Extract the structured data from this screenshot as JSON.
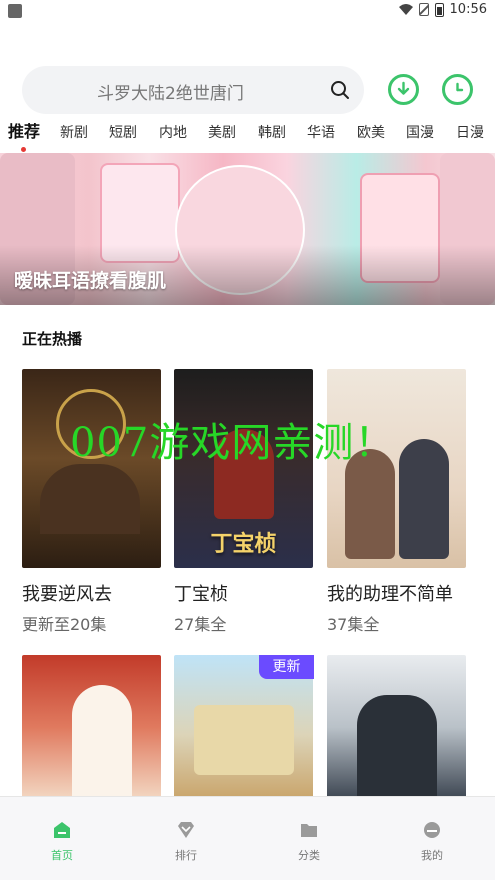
{
  "status_bar": {
    "time": "10:56"
  },
  "search": {
    "placeholder": "斗罗大陆2绝世唐门"
  },
  "icons": {
    "search": "search-icon",
    "download": "download-icon",
    "history": "clock-icon"
  },
  "tabs": [
    "推荐",
    "新剧",
    "短剧",
    "内地",
    "美剧",
    "韩剧",
    "华语",
    "欧美",
    "国漫",
    "日漫"
  ],
  "active_tab": "推荐",
  "banner": {
    "title": "暧昧耳语撩看腹肌"
  },
  "section": {
    "title": "正在热播"
  },
  "cards": [
    {
      "title": "我要逆风去",
      "subtitle": "更新至20集",
      "poster_text": ""
    },
    {
      "title": "丁宝桢",
      "subtitle": "27集全",
      "poster_text": "丁宝桢"
    },
    {
      "title": "我的助理不简单",
      "subtitle": "37集全",
      "poster_text": ""
    },
    {
      "title": "",
      "subtitle": "",
      "poster_text": ""
    },
    {
      "title": "",
      "subtitle": "",
      "poster_text": "",
      "badge": "更新"
    },
    {
      "title": "",
      "subtitle": "",
      "poster_text": ""
    }
  ],
  "watermark": "007游戏网亲测！",
  "bottom_nav": [
    {
      "label": "首页",
      "icon": "home-icon"
    },
    {
      "label": "排行",
      "icon": "rank-icon"
    },
    {
      "label": "分类",
      "icon": "folder-icon"
    },
    {
      "label": "我的",
      "icon": "profile-icon"
    }
  ],
  "colors": {
    "accent": "#3cc46b",
    "badge": "#6b4bff",
    "active_dot": "#e53935"
  }
}
